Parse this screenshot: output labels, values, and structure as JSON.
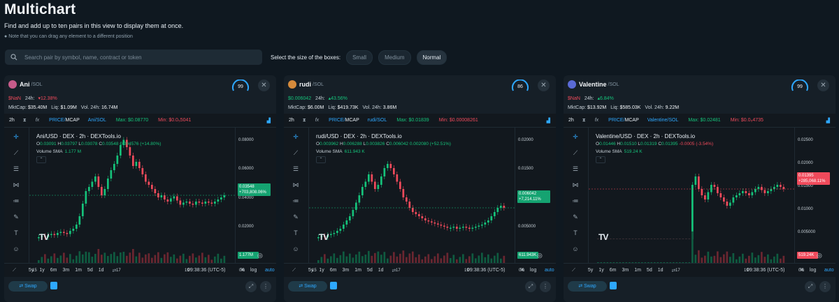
{
  "header": {
    "title": "Multichart",
    "subtitle": "Find and add up to ten pairs in this view to display them at once.",
    "note": "Note that you can drag any element to a different position"
  },
  "search": {
    "placeholder": "Search pair by symbol, name, contract or token"
  },
  "sizes": {
    "label": "Select the size of the boxes:",
    "options": [
      "Small",
      "Medium",
      "Normal"
    ],
    "selected": "Normal"
  },
  "colors": {
    "green": "#15c27a",
    "red": "#f04a5b",
    "blue": "#2ea8ff"
  },
  "panels": [
    {
      "name": "Ani",
      "chain": "SOL",
      "score": "99",
      "price": "$NaN",
      "change_label": "24h:",
      "change": "▾12.38%",
      "change_dir": "down",
      "mktcap": "$35.40M",
      "liq": "$1.09M",
      "vol": "16.74M",
      "toolbar": {
        "tf": "2h",
        "pm_a": "PRICE",
        "pm_b": "MCAP",
        "pair": "Ani/SOL",
        "max": "Max: $0.08770",
        "min": "Min: $0.0₅5041"
      },
      "legend": "Ani/USD · DEX · 2h · DEXTools.io",
      "ohlc": {
        "o": "0.03091",
        "h": "0.03797",
        "l": "0.03078",
        "c": "0.03548",
        "chg": "0.004576 (+14.80%)"
      },
      "volume": "1.177 M",
      "yticks": [
        "0.08000",
        "0.06000",
        "0.04000",
        "0.02000",
        "-0.0000"
      ],
      "price_tag": "0.03548",
      "pct_tag": "+703,808.06%",
      "vol_tag": "1.177M",
      "xticks": [
        "15",
        "17",
        "19",
        "04:"
      ],
      "ranges": [
        "5y",
        "1y",
        "6m",
        "3m",
        "1m",
        "5d",
        "1d"
      ],
      "time": "09:38:36 (UTC-5)",
      "pct": "%",
      "log": "log",
      "auto": "auto",
      "swap": "Swap"
    },
    {
      "name": "rudi",
      "chain": "SOL",
      "score": "86",
      "price": "$0.006042",
      "change_label": "24h:",
      "change": "▴43.56%",
      "change_dir": "up",
      "mktcap": "$6.00M",
      "liq": "$419.73K",
      "vol": "3.86M",
      "toolbar": {
        "tf": "2h",
        "pm_a": "PRICE",
        "pm_b": "MCAP",
        "pair": "rudi/SOL",
        "max": "Max: $0.01839",
        "min": "Min: $0.00008261"
      },
      "legend": "rudi/USD · DEX · 2h · DEXTools.io",
      "ohlc": {
        "o": "0.003962",
        "h": "0.006288",
        "l": "0.003826",
        "c": "0.006042",
        "chg": "0.002080 (+52.51%)"
      },
      "volume": "611.943 K",
      "yticks": [
        "0.02000",
        "0.01500",
        "0.01000",
        "0.005000",
        "-0.0000"
      ],
      "price_tag": "0.006042",
      "pct_tag": "+7,214.11%",
      "vol_tag": "611.943K",
      "xticks": [
        "15",
        "17",
        "19",
        "04:"
      ],
      "ranges": [
        "5y",
        "1y",
        "6m",
        "3m",
        "1m",
        "5d",
        "1d"
      ],
      "time": "09:38:36 (UTC-5)",
      "pct": "%",
      "log": "log",
      "auto": "auto",
      "swap": "Swap"
    },
    {
      "name": "Valentine",
      "chain": "SOL",
      "score": "99",
      "price": "$NaN",
      "change_label": "24h:",
      "change": "▴6.84%",
      "change_dir": "up",
      "mktcap": "$13.92M",
      "liq": "$585.03K",
      "vol": "9.22M",
      "toolbar": {
        "tf": "2h",
        "pm_a": "PRICE",
        "pm_b": "MCAP",
        "pair": "Valentine/SOL",
        "max": "Max: $0.02481",
        "min": "Min: $0.0₅4735"
      },
      "legend": "Valentine/USD · DEX · 2h · DEXTools.io",
      "ohlc": {
        "o": "0.01446",
        "h": "0.01510",
        "l": "0.01319",
        "c": "0.01395",
        "chg": "-0.0005 (-3.54%)"
      },
      "volume": "519.24 K",
      "yticks": [
        "0.02500",
        "0.02000",
        "0.01500",
        "0.01000",
        "0.005000",
        "-0.0000"
      ],
      "price_tag": "0.01395",
      "pct_tag": "+285,068.11%",
      "vol_tag": "519.24K",
      "xticks": [
        "17",
        "19",
        "04:"
      ],
      "ranges": [
        "5y",
        "1y",
        "6m",
        "3m",
        "1m",
        "5d",
        "1d"
      ],
      "time": "09:38:36 (UTC-5)",
      "pct": "%",
      "log": "log",
      "auto": "auto",
      "swap": "Swap"
    }
  ],
  "labels": {
    "mktcap": "MktCap:",
    "liq": "Liq:",
    "vol": "Vol. 24h:",
    "o": "O",
    "h": "H",
    "l": "L",
    "c": "C",
    "volsma": "Volume SMA"
  }
}
